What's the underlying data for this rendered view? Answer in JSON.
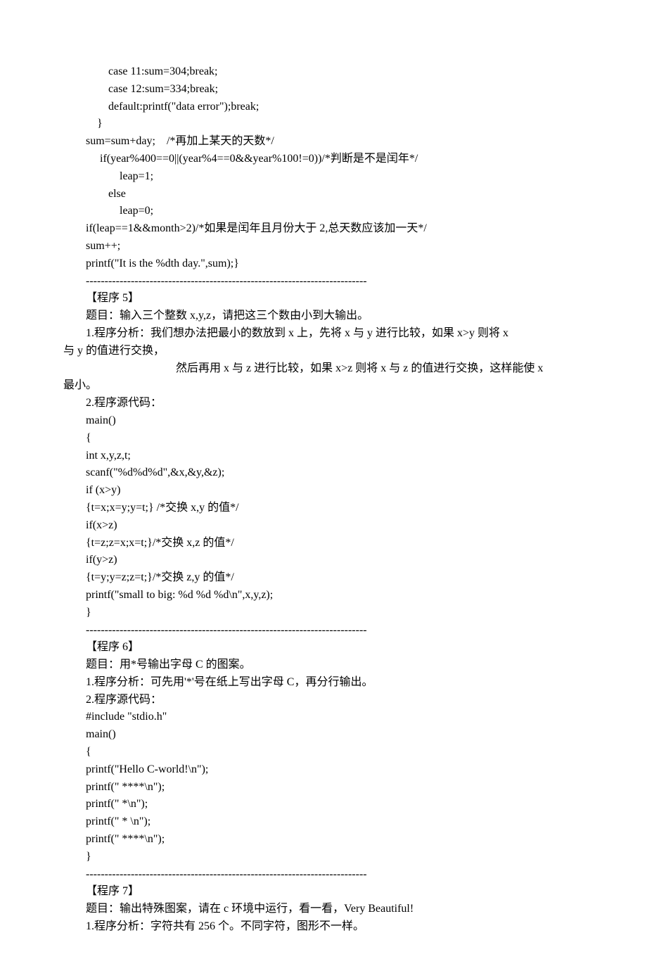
{
  "lines": [
    {
      "cls": "indent3",
      "text": "case 11:sum=304;break;"
    },
    {
      "cls": "indent3",
      "text": "case 12:sum=334;break;"
    },
    {
      "cls": "indent3",
      "text": "default:printf(\"data error\");break;"
    },
    {
      "cls": "indent2",
      "text": "}"
    },
    {
      "cls": "indent1",
      "text": "sum=sum+day;　/*再加上某天的天数*/"
    },
    {
      "cls": "indent2",
      "text": " if(year%400==0||(year%4==0&&year%100!=0))/*判断是不是闰年*/"
    },
    {
      "cls": "indent4",
      "text": "leap=1;"
    },
    {
      "cls": "indent3",
      "text": "else"
    },
    {
      "cls": "indent4",
      "text": "leap=0;"
    },
    {
      "cls": "indent1",
      "text": "if(leap==1&&month>2)/*如果是闰年且月份大于 2,总天数应该加一天*/"
    },
    {
      "cls": "indent1",
      "text": "sum++;"
    },
    {
      "cls": "indent1",
      "text": "printf(\"It is the %dth day.\",sum);}"
    },
    {
      "cls": "indent1",
      "text": "---------------------------------------------------------------------------"
    },
    {
      "cls": "indent1",
      "text": "【程序 5】"
    },
    {
      "cls": "indent1",
      "text": "题目：输入三个整数 x,y,z，请把这三个数由小到大输出。"
    },
    {
      "cls": "indent1",
      "text": "1.程序分析：我们想办法把最小的数放到 x 上，先将 x 与 y 进行比较，如果 x>y 则将 x"
    },
    {
      "cls": "noindent",
      "text": "与 y 的值进行交换，"
    },
    {
      "cls": "indent-large",
      "text": "然后再用 x 与 z 进行比较，如果 x>z 则将 x 与 z 的值进行交换，这样能使 x"
    },
    {
      "cls": "noindent",
      "text": "最小。"
    },
    {
      "cls": "indent1",
      "text": "2.程序源代码："
    },
    {
      "cls": "indent1",
      "text": "main()"
    },
    {
      "cls": "indent1",
      "text": "{"
    },
    {
      "cls": "indent1",
      "text": "int x,y,z,t;"
    },
    {
      "cls": "indent1",
      "text": "scanf(\"%d%d%d\",&x,&y,&z);"
    },
    {
      "cls": "indent1",
      "text": "if (x>y)"
    },
    {
      "cls": "indent1",
      "text": "{t=x;x=y;y=t;} /*交换 x,y 的值*/"
    },
    {
      "cls": "indent1",
      "text": "if(x>z)"
    },
    {
      "cls": "indent1",
      "text": "{t=z;z=x;x=t;}/*交换 x,z 的值*/"
    },
    {
      "cls": "indent1",
      "text": "if(y>z)"
    },
    {
      "cls": "indent1",
      "text": "{t=y;y=z;z=t;}/*交换 z,y 的值*/"
    },
    {
      "cls": "indent1",
      "text": "printf(\"small to big: %d %d %d\\n\",x,y,z);"
    },
    {
      "cls": "indent1",
      "text": "}"
    },
    {
      "cls": "indent1",
      "text": "---------------------------------------------------------------------------"
    },
    {
      "cls": "indent1",
      "text": "【程序 6】"
    },
    {
      "cls": "indent1",
      "text": "题目：用*号输出字母 C 的图案。"
    },
    {
      "cls": "indent1",
      "text": "1.程序分析：可先用'*'号在纸上写出字母 C，再分行输出。"
    },
    {
      "cls": "indent1",
      "text": "2.程序源代码："
    },
    {
      "cls": "indent1",
      "text": "#include \"stdio.h\""
    },
    {
      "cls": "indent1",
      "text": "main()"
    },
    {
      "cls": "indent1",
      "text": "{"
    },
    {
      "cls": "indent1",
      "text": "printf(\"Hello C-world!\\n\");"
    },
    {
      "cls": "indent1",
      "text": "printf(\" ****\\n\");"
    },
    {
      "cls": "indent1",
      "text": "printf(\" *\\n\");"
    },
    {
      "cls": "indent1",
      "text": "printf(\" * \\n\");"
    },
    {
      "cls": "indent1",
      "text": "printf(\" ****\\n\");"
    },
    {
      "cls": "indent1",
      "text": "}"
    },
    {
      "cls": "indent1",
      "text": "---------------------------------------------------------------------------"
    },
    {
      "cls": "indent1",
      "text": "【程序 7】"
    },
    {
      "cls": "indent1",
      "text": "题目：输出特殊图案，请在 c 环境中运行，看一看，Very Beautiful!"
    },
    {
      "cls": "indent1",
      "text": "1.程序分析：字符共有 256 个。不同字符，图形不一样。"
    }
  ]
}
